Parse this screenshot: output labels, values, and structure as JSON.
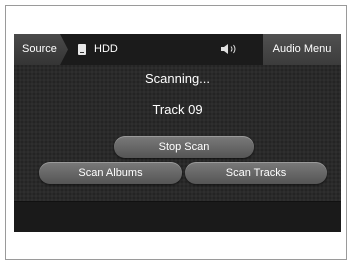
{
  "topbar": {
    "source_label": "Source",
    "device_label": "HDD",
    "menu_label": "Audio Menu"
  },
  "status": {
    "line1": "Scanning...",
    "line2": "Track 09"
  },
  "buttons": {
    "stop_scan": "Stop Scan",
    "scan_albums": "Scan Albums",
    "scan_tracks": "Scan Tracks"
  },
  "icons": {
    "device": "hdd-icon",
    "volume": "volume-icon"
  }
}
